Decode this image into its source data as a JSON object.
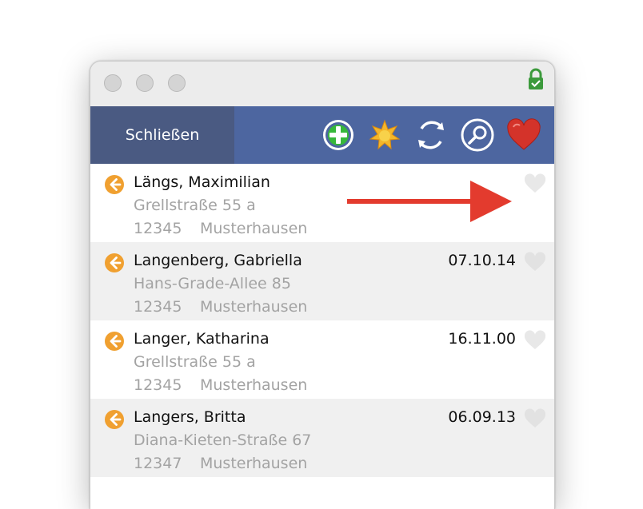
{
  "toolbar": {
    "close_label": "Schließen",
    "icons": [
      "add-icon",
      "sun-icon",
      "refresh-icon",
      "search-icon",
      "heart-icon"
    ]
  },
  "contacts": [
    {
      "name": "Längs, Maximilian",
      "street": "Grellstraße 55 a",
      "zip": "12345",
      "city": "Musterhausen",
      "date": ""
    },
    {
      "name": "Langenberg, Gabriella",
      "street": "Hans-Grade-Allee 85",
      "zip": "12345",
      "city": "Musterhausen",
      "date": "07.10.14"
    },
    {
      "name": "Langer, Katharina",
      "street": "Grellstraße 55 a",
      "zip": "12345",
      "city": "Musterhausen",
      "date": "16.11.00"
    },
    {
      "name": "Langers, Britta",
      "street": "Diana-Kieten-Straße 67",
      "zip": "12347",
      "city": "Musterhausen",
      "date": "06.09.13"
    }
  ],
  "colors": {
    "toolbar": "#4d66a0",
    "close_button": "#4a5a82",
    "row_alt": "#f0f0f0",
    "arrow_orange": "#f0a030",
    "annotation_red": "#e33b2e"
  }
}
